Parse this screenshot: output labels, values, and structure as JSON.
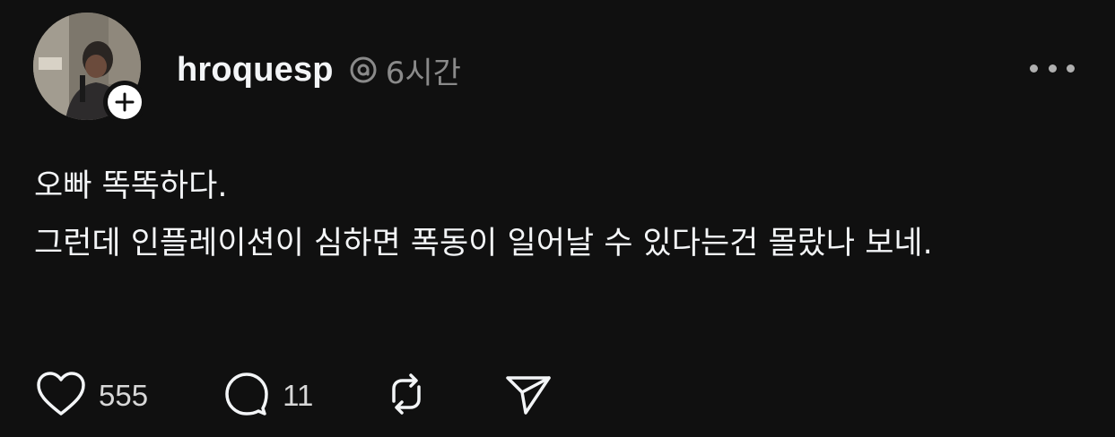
{
  "post": {
    "username": "hroquesp",
    "time": "6시간",
    "body_lines": [
      "오빠 똑똑하다.",
      "그런데 인플레이션이 심하면 폭동이 일어날 수 있다는건 몰랐나 보네."
    ],
    "like_count": "555",
    "reply_count": "11"
  },
  "icons": {
    "follow": "plus-icon",
    "threads": "threads-icon",
    "more": "more-horizontal-icon",
    "like": "heart-icon",
    "reply": "comment-icon",
    "repost": "repost-icon",
    "share": "send-icon"
  },
  "colors": {
    "background": "#101010",
    "text": "#f3f5f7",
    "muted": "#8a8a8a"
  }
}
